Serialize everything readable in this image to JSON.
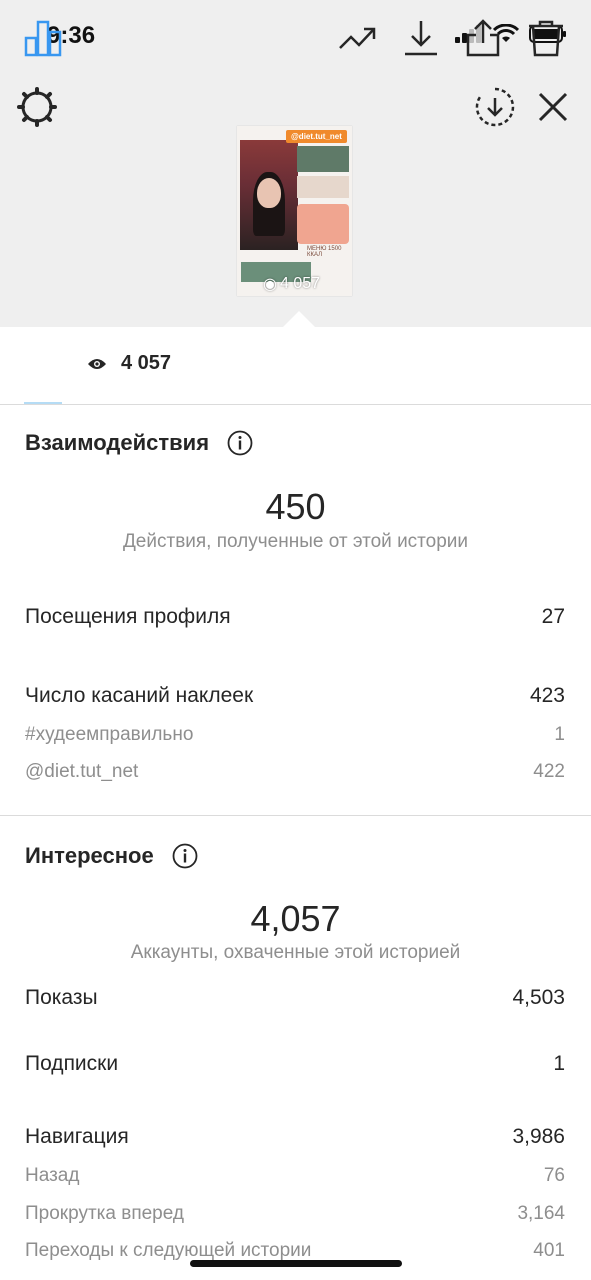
{
  "status_bar": {
    "time": "9:36"
  },
  "preview": {
    "handle": "@diet.tut_net",
    "views": "4 057",
    "menu_text": "МЕНЮ 1500 ККАЛ"
  },
  "toolbar": {
    "views": "4 057"
  },
  "interactions": {
    "title": "Взаимодействия",
    "total": "450",
    "total_caption": "Действия, полученные от этой истории",
    "rows": [
      {
        "label": "Посещения профиля",
        "value": "27"
      },
      {
        "label": "Число касаний наклеек",
        "value": "423"
      }
    ],
    "sub_rows": [
      {
        "label": "#худеемправильно",
        "value": "1"
      },
      {
        "label": "@diet.tut_net",
        "value": "422"
      }
    ]
  },
  "discovery": {
    "title": "Интересное",
    "total": "4,057",
    "total_caption": "Аккаунты, охваченные этой историей",
    "rows": [
      {
        "label": "Показы",
        "value": "4,503"
      },
      {
        "label": "Подписки",
        "value": "1"
      },
      {
        "label": "Навигация",
        "value": "3,986"
      }
    ],
    "sub_rows": [
      {
        "label": "Назад",
        "value": "76"
      },
      {
        "label": "Прокрутка вперед",
        "value": "3,164"
      },
      {
        "label": "Переходы к следующей истории",
        "value": "401"
      }
    ]
  },
  "colors": {
    "accent": "#3897f0",
    "muted": "#8e8e8e",
    "text": "#262626"
  }
}
